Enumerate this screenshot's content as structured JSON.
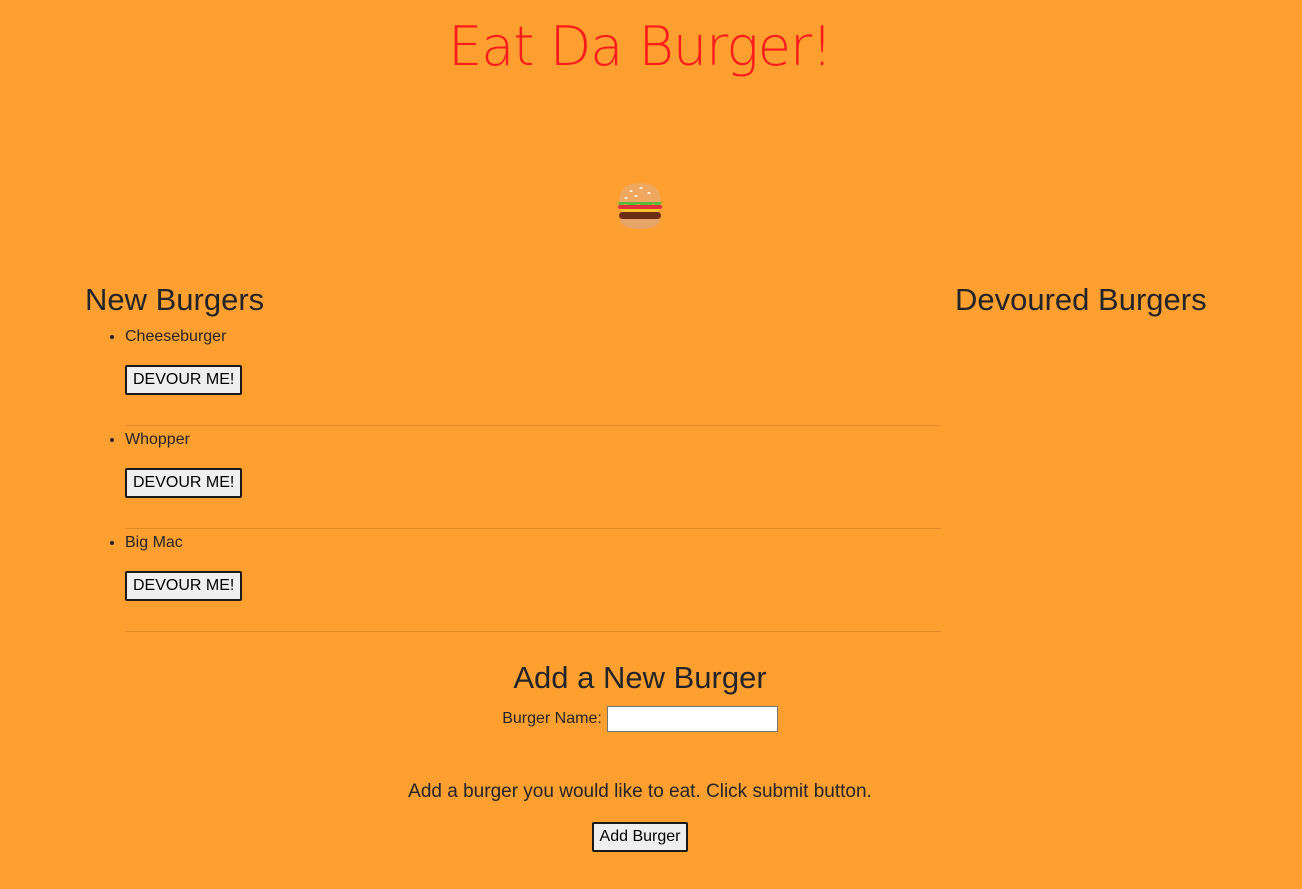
{
  "header": {
    "title": "Eat Da Burger!",
    "logo_icon": "burger-icon"
  },
  "new_burgers": {
    "heading": "New Burgers",
    "items": [
      {
        "name": "Cheeseburger",
        "button_label": "DEVOUR ME!"
      },
      {
        "name": "Whopper",
        "button_label": "DEVOUR ME!"
      },
      {
        "name": "Big Mac",
        "button_label": "DEVOUR ME!"
      }
    ]
  },
  "devoured_burgers": {
    "heading": "Devoured Burgers",
    "items": []
  },
  "add_form": {
    "heading": "Add a New Burger",
    "field_label": "Burger Name:",
    "field_value": "",
    "instructions": "Add a burger you would like to eat. Click submit button.",
    "submit_label": "Add Burger"
  },
  "colors": {
    "background": "#ff9f30",
    "title": "#ff1a1a",
    "text": "#212529"
  }
}
